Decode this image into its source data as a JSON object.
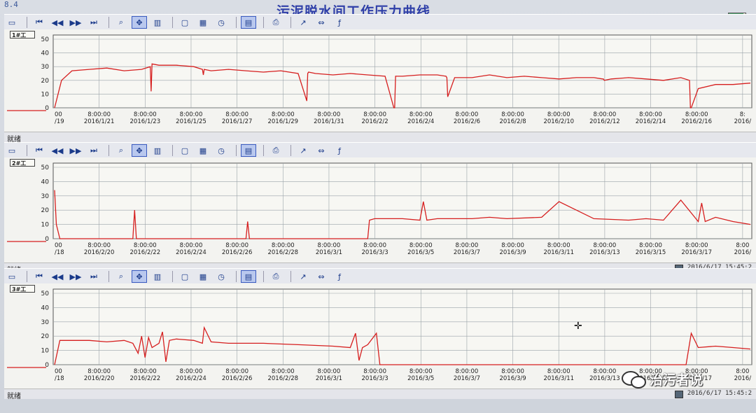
{
  "window": {
    "corner_label": "8.4",
    "title": "污泥脱水间工作压力曲线"
  },
  "panels": [
    {
      "tag": "1#工",
      "status": "就绪",
      "timestamp": "",
      "first_tick": "00\n/19",
      "ticks": [
        {
          "t": "8:00:00",
          "d": "2016/1/21"
        },
        {
          "t": "8:00:00",
          "d": "2016/1/23"
        },
        {
          "t": "8:00:00",
          "d": "2016/1/25"
        },
        {
          "t": "8:00:00",
          "d": "2016/1/27"
        },
        {
          "t": "8:00:00",
          "d": "2016/1/29"
        },
        {
          "t": "8:00:00",
          "d": "2016/1/31"
        },
        {
          "t": "8:00:00",
          "d": "2016/2/2"
        },
        {
          "t": "8:00:00",
          "d": "2016/2/4"
        },
        {
          "t": "8:00:00",
          "d": "2016/2/6"
        },
        {
          "t": "8:00:00",
          "d": "2016/2/8"
        },
        {
          "t": "8:00:00",
          "d": "2016/2/10"
        },
        {
          "t": "8:00:00",
          "d": "2016/2/12"
        },
        {
          "t": "8:00:00",
          "d": "2016/2/14"
        },
        {
          "t": "8:00:00",
          "d": "2016/2/16"
        },
        {
          "t": "8:",
          "d": "2016/"
        }
      ]
    },
    {
      "tag": "2#工",
      "status": "就绪",
      "timestamp": "2016/6/17   15:45:2",
      "first_tick": "00\n/18",
      "ticks": [
        {
          "t": "8:00:00",
          "d": "2016/2/20"
        },
        {
          "t": "8:00:00",
          "d": "2016/2/22"
        },
        {
          "t": "8:00:00",
          "d": "2016/2/24"
        },
        {
          "t": "8:00:00",
          "d": "2016/2/26"
        },
        {
          "t": "8:00:00",
          "d": "2016/2/28"
        },
        {
          "t": "8:00:00",
          "d": "2016/3/1"
        },
        {
          "t": "8:00:00",
          "d": "2016/3/3"
        },
        {
          "t": "8:00:00",
          "d": "2016/3/5"
        },
        {
          "t": "8:00:00",
          "d": "2016/3/7"
        },
        {
          "t": "8:00:00",
          "d": "2016/3/9"
        },
        {
          "t": "8:00:00",
          "d": "2016/3/11"
        },
        {
          "t": "8:00:00",
          "d": "2016/3/13"
        },
        {
          "t": "8:00:00",
          "d": "2016/3/15"
        },
        {
          "t": "8:00:00",
          "d": "2016/3/17"
        },
        {
          "t": "8:00",
          "d": "2016/"
        }
      ]
    },
    {
      "tag": "3#工",
      "status": "就绪",
      "timestamp": "2016/6/17   15:45:2",
      "first_tick": "00\n/18",
      "ticks": [
        {
          "t": "8:00:00",
          "d": "2016/2/20"
        },
        {
          "t": "8:00:00",
          "d": "2016/2/22"
        },
        {
          "t": "8:00:00",
          "d": "2016/2/24"
        },
        {
          "t": "8:00:00",
          "d": "2016/2/26"
        },
        {
          "t": "8:00:00",
          "d": "2016/2/28"
        },
        {
          "t": "8:00:00",
          "d": "2016/3/1"
        },
        {
          "t": "8:00:00",
          "d": "2016/3/3"
        },
        {
          "t": "8:00:00",
          "d": "2016/3/5"
        },
        {
          "t": "8:00:00",
          "d": "2016/3/7"
        },
        {
          "t": "8:00:00",
          "d": "2016/3/9"
        },
        {
          "t": "8:00:00",
          "d": "2016/3/11"
        },
        {
          "t": "8:00:00",
          "d": "2016/3/13"
        },
        {
          "t": "8:00:00",
          "d": "2016/3/15"
        },
        {
          "t": "8:00:00",
          "d": "2016/3/17"
        },
        {
          "t": "8:00",
          "d": "2016/"
        }
      ]
    }
  ],
  "toolbar": {
    "icons": [
      "page-icon",
      "first-icon",
      "prev-icon",
      "next-icon",
      "last-icon",
      "zoom-icon",
      "pan-icon",
      "bars-icon",
      "window-icon",
      "grid-icon",
      "clock-icon",
      "table-icon",
      "print-icon",
      "cursor-icon",
      "fit-icon",
      "fx-icon"
    ]
  },
  "watermark": {
    "text": "治污者说"
  },
  "colors": {
    "trace": "#d61f1f",
    "grid": "#9aa3a8",
    "title": "#2f3fa8"
  },
  "chart_data": [
    {
      "type": "line",
      "title": "",
      "yticks": [
        0,
        10,
        20,
        30,
        40,
        50
      ],
      "ylim": [
        0,
        50
      ],
      "grid": true,
      "series": [
        {
          "x": [
            0,
            0.4,
            1,
            2,
            3,
            4,
            5,
            5.5,
            5.55,
            5.6,
            6,
            7,
            8,
            8.5,
            8.55,
            8.6,
            9,
            10,
            11,
            12,
            13,
            14,
            14.5,
            14.55,
            14.6,
            15,
            16,
            17,
            18,
            19,
            19.5,
            19.55,
            19.6,
            20,
            21,
            22,
            22.5,
            22.55,
            22.6,
            23,
            24,
            25,
            26,
            27,
            28,
            29,
            30,
            31,
            31.5,
            31.55,
            31.6,
            32,
            33,
            34,
            35,
            36,
            36.5,
            36.55,
            36.6,
            37,
            38,
            39,
            40
          ],
          "values": [
            0,
            20,
            27,
            28,
            29,
            27,
            28,
            30,
            12,
            32,
            31,
            31,
            30,
            28,
            24,
            28,
            27,
            28,
            27,
            26,
            27,
            25,
            5,
            25,
            26,
            25,
            24,
            25,
            24,
            23,
            0,
            0,
            23,
            23,
            24,
            24,
            23,
            22,
            8,
            22,
            22,
            24,
            22,
            23,
            22,
            21,
            22,
            22,
            21,
            21,
            20,
            21,
            22,
            21,
            20,
            22,
            20,
            0,
            0,
            14,
            17,
            17,
            18
          ]
        }
      ]
    },
    {
      "type": "line",
      "title": "",
      "yticks": [
        0,
        10,
        20,
        30,
        40,
        50
      ],
      "ylim": [
        0,
        50
      ],
      "grid": true,
      "series": [
        {
          "x": [
            0,
            0.1,
            0.3,
            1,
            4,
            4.5,
            4.6,
            4.7,
            5,
            10,
            11,
            11.1,
            11.2,
            12,
            18,
            18.1,
            18.4,
            20,
            21,
            21.2,
            21.4,
            22,
            24,
            25,
            26,
            28,
            29,
            31,
            33,
            34,
            35,
            36,
            37,
            37.2,
            37.4,
            38,
            39,
            40
          ],
          "values": [
            34,
            10,
            0,
            0,
            0,
            0,
            20,
            0,
            0,
            0,
            0,
            12,
            0,
            0,
            0,
            13,
            14,
            14,
            13,
            26,
            13,
            14,
            14,
            15,
            14,
            15,
            26,
            14,
            13,
            14,
            13,
            27,
            12,
            25,
            12,
            15,
            12,
            10
          ]
        }
      ]
    },
    {
      "type": "line",
      "title": "",
      "yticks": [
        0,
        10,
        20,
        30,
        40,
        50
      ],
      "ylim": [
        0,
        50
      ],
      "grid": true,
      "series": [
        {
          "x": [
            0,
            0.3,
            1,
            2,
            3,
            4,
            4.5,
            4.8,
            5,
            5.2,
            5.4,
            5.6,
            6,
            6.2,
            6.4,
            6.6,
            7,
            8,
            8.5,
            8.6,
            9,
            10,
            12,
            14,
            16,
            17,
            17.3,
            17.5,
            17.7,
            18,
            18.5,
            18.7,
            19,
            20,
            22,
            24,
            30,
            31,
            32,
            35,
            36,
            36.3,
            36.6,
            37,
            38,
            39,
            40
          ],
          "values": [
            0,
            17,
            17,
            17,
            16,
            17,
            15,
            8,
            20,
            5,
            19,
            12,
            15,
            23,
            2,
            17,
            18,
            17,
            15,
            26,
            16,
            15,
            15,
            14,
            13,
            12,
            22,
            3,
            12,
            14,
            22,
            0,
            0,
            0,
            0,
            0,
            0,
            0,
            0,
            0,
            0,
            0,
            22,
            12,
            13,
            12,
            11
          ]
        }
      ]
    }
  ]
}
